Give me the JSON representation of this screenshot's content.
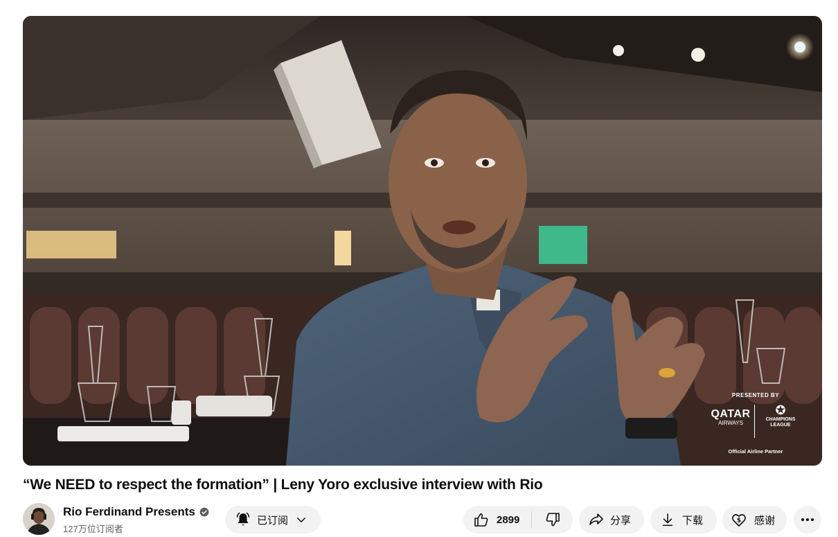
{
  "video": {
    "title": "“We NEED to respect the formation” | Leny Yoro exclusive interview with Rio",
    "sponsor": {
      "presented_by": "PRESENTED BY",
      "airline_line1": "QATAR",
      "airline_line2": "AIRWAYS",
      "league_line1": "CHAMPIONS",
      "league_line2": "LEAGUE",
      "official": "Official Airline Partner"
    }
  },
  "channel": {
    "name": "Rio Ferdinand Presents",
    "subscribers": "127万位订阅者",
    "verified": true
  },
  "actions": {
    "subscribe_label": "已订阅",
    "like_count": "2899",
    "share_label": "分享",
    "download_label": "下载",
    "thanks_label": "感谢"
  },
  "icons": {
    "subscribe": "bell-icon",
    "subscribe_menu": "chevron-down-icon",
    "like": "thumbs-up-icon",
    "dislike": "thumbs-down-icon",
    "share": "share-arrow-icon",
    "download": "download-icon",
    "thanks": "thanks-heart-dollar-icon",
    "more": "more-horizontal-icon",
    "verified": "verified-check-icon"
  },
  "colors": {
    "pill_background": "#f2f2f2",
    "text_primary": "#0f0f0f",
    "text_secondary": "#606060"
  }
}
